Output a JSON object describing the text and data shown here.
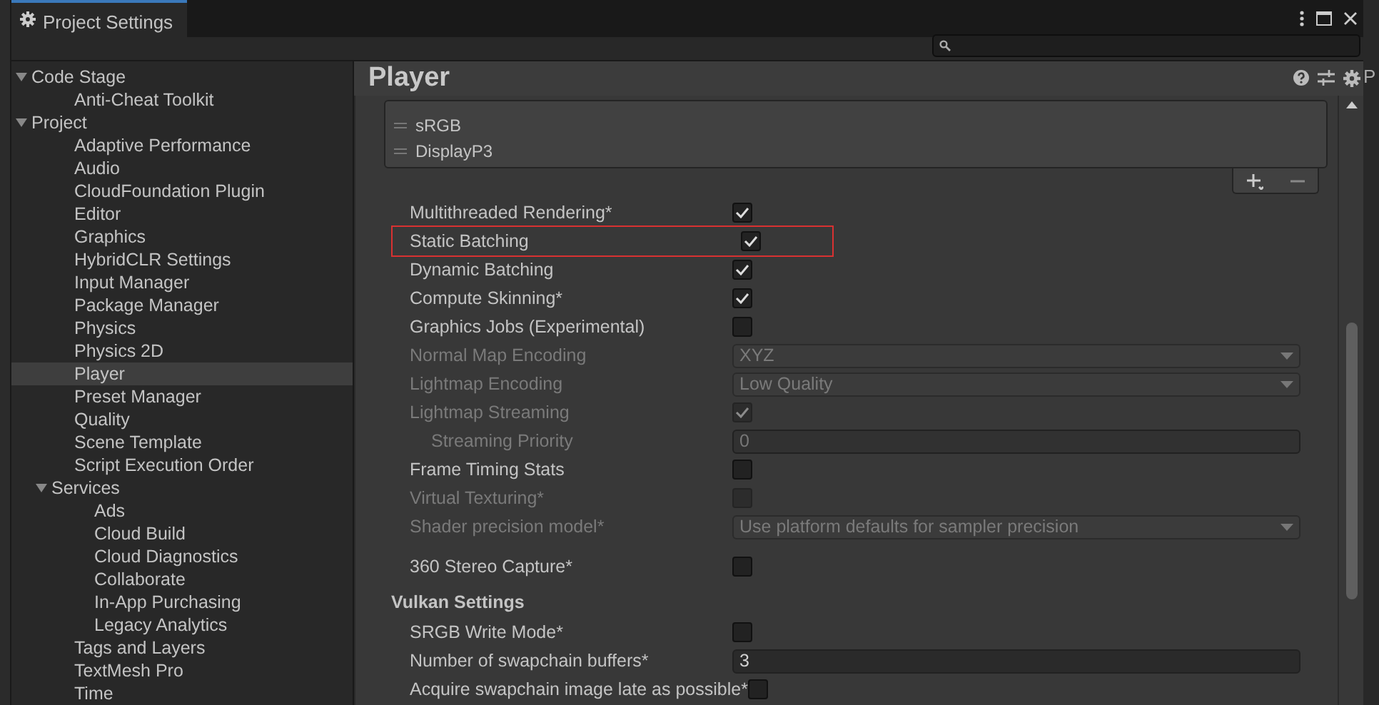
{
  "window": {
    "title": "Project Settings"
  },
  "sidebar": {
    "items": [
      {
        "label": "Code Stage",
        "expanded": true,
        "selected": false,
        "children": [
          {
            "label": "Anti-Cheat Toolkit",
            "selected": false
          }
        ]
      },
      {
        "label": "Project",
        "expanded": true,
        "selected": false,
        "children": [
          {
            "label": "Adaptive Performance",
            "selected": false
          },
          {
            "label": "Audio",
            "selected": false
          },
          {
            "label": "CloudFoundation Plugin",
            "selected": false
          },
          {
            "label": "Editor",
            "selected": false
          },
          {
            "label": "Graphics",
            "selected": false
          },
          {
            "label": "HybridCLR Settings",
            "selected": false
          },
          {
            "label": "Input Manager",
            "selected": false
          },
          {
            "label": "Package Manager",
            "selected": false
          },
          {
            "label": "Physics",
            "selected": false
          },
          {
            "label": "Physics 2D",
            "selected": false
          },
          {
            "label": "Player",
            "selected": true
          },
          {
            "label": "Preset Manager",
            "selected": false
          },
          {
            "label": "Quality",
            "selected": false
          },
          {
            "label": "Scene Template",
            "selected": false
          },
          {
            "label": "Script Execution Order",
            "selected": false
          },
          {
            "label": "Services",
            "expanded": true,
            "selected": false,
            "children": [
              {
                "label": "Ads",
                "selected": false
              },
              {
                "label": "Cloud Build",
                "selected": false
              },
              {
                "label": "Cloud Diagnostics",
                "selected": false
              },
              {
                "label": "Collaborate",
                "selected": false
              },
              {
                "label": "In-App Purchasing",
                "selected": false
              },
              {
                "label": "Legacy Analytics",
                "selected": false
              }
            ]
          },
          {
            "label": "Tags and Layers",
            "selected": false
          },
          {
            "label": "TextMesh Pro",
            "selected": false
          },
          {
            "label": "Time",
            "selected": false
          }
        ]
      }
    ]
  },
  "panel": {
    "title": "Player",
    "color_gamut_list": [
      "sRGB",
      "DisplayP3"
    ],
    "rows": [
      {
        "kind": "checkbox",
        "label": "Multithreaded Rendering*",
        "checked": true,
        "disabled": false
      },
      {
        "kind": "checkbox",
        "label": "Static Batching",
        "checked": true,
        "disabled": false,
        "highlighted": true
      },
      {
        "kind": "checkbox",
        "label": "Dynamic Batching",
        "checked": true,
        "disabled": false
      },
      {
        "kind": "checkbox",
        "label": "Compute Skinning*",
        "checked": true,
        "disabled": false
      },
      {
        "kind": "checkbox",
        "label": "Graphics Jobs (Experimental)",
        "checked": false,
        "disabled": false
      },
      {
        "kind": "dropdown",
        "label": "Normal Map Encoding",
        "value": "XYZ",
        "disabled": true
      },
      {
        "kind": "dropdown",
        "label": "Lightmap Encoding",
        "value": "Low Quality",
        "disabled": true
      },
      {
        "kind": "checkbox",
        "label": "Lightmap Streaming",
        "checked": true,
        "disabled": true,
        "children": [
          {
            "kind": "field",
            "label": "Streaming Priority",
            "value": "0",
            "disabled": true
          }
        ]
      },
      {
        "kind": "checkbox",
        "label": "Frame Timing Stats",
        "checked": false,
        "disabled": false
      },
      {
        "kind": "checkbox",
        "label": "Virtual Texturing*",
        "checked": false,
        "disabled": true
      },
      {
        "kind": "dropdown",
        "label": "Shader precision model*",
        "value": "Use platform defaults for sampler precision",
        "disabled": true
      },
      {
        "kind": "checkbox",
        "label": "360 Stereo Capture*",
        "checked": false,
        "disabled": false,
        "spaced": true
      },
      {
        "kind": "heading",
        "label": "Vulkan Settings"
      },
      {
        "kind": "checkbox",
        "label": "SRGB Write Mode*",
        "checked": false,
        "disabled": false
      },
      {
        "kind": "field",
        "label": "Number of swapchain buffers*",
        "value": "3",
        "disabled": false
      },
      {
        "kind": "checkbox",
        "label": "Acquire swapchain image late as possible*",
        "checked": false,
        "disabled": false
      }
    ]
  },
  "side_strip": {
    "text": "P"
  }
}
